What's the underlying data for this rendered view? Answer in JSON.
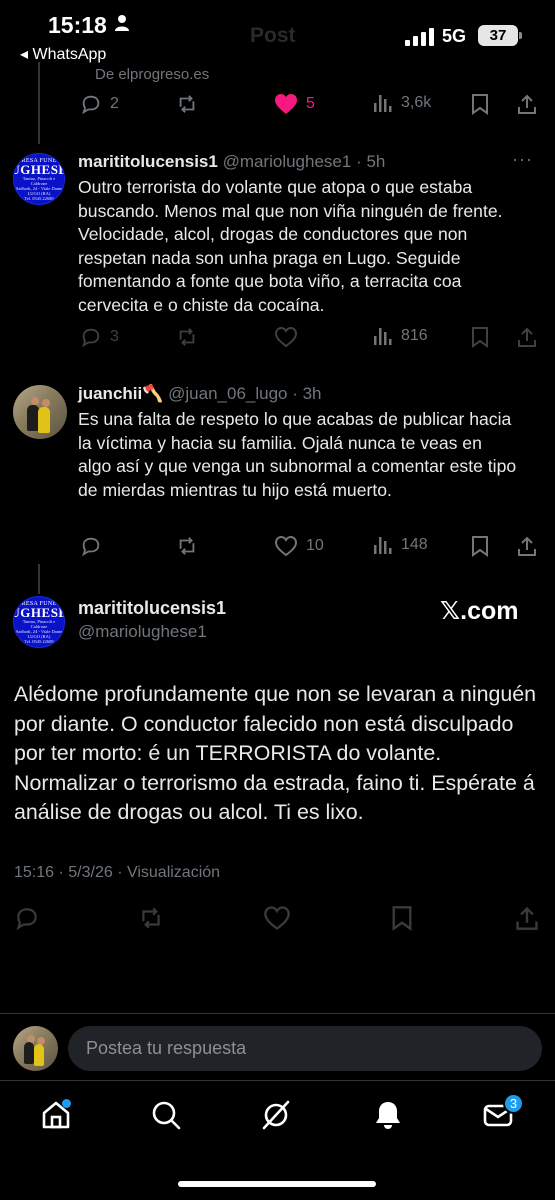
{
  "status_bar": {
    "time": "15:18",
    "back_app": "◂ WhatsApp",
    "network": "5G",
    "battery": "37"
  },
  "header": {
    "title": "Post"
  },
  "context_tweet": {
    "source": "De elprogreso.es",
    "replies": "2",
    "retweets": "",
    "likes": "5",
    "views": "3,6k"
  },
  "replies": [
    {
      "name": "marititolucensis1",
      "handle": "@mariolughese1 · 5h",
      "avatar_text": [
        "RESA FUNE",
        "UGHESE",
        "Tanino, Pinacoli e Caldrone",
        "Sadhodi, 24 - Viale Dante",
        "LUGO (RA)",
        "Tel. 0545.22688"
      ],
      "text": "Outro terrorista do volante que atopa o que estaba buscando. Menos mal que non viña ninguén de frente. Velocidade, alcol, drogas de conductores que non respetan nada son unha praga en Lugo. Seguide fomentando a fonte que bota viño, a terracita coa cervecita e o chiste da cocaína.",
      "replies": "3",
      "likes": "",
      "views": "816"
    },
    {
      "name": "juanchii🪓",
      "handle": "@juan_06_lugo · 3h",
      "text": "Es una falta de respeto lo que acabas de publicar hacia la víctima y hacia su familia. Ojalá nunca te veas en algo así y que venga un subnormal a comentar este tipo de mierdas mientras tu hijo está muerto.",
      "replies": "",
      "likes": "10",
      "views": "148"
    }
  ],
  "main_tweet": {
    "name": "marititolucensis1",
    "handle": "@mariolughese1",
    "avatar_text": [
      "RESA FUNE",
      "UGHESE",
      "Tanino, Pinacoli e Caldrone",
      "Sadhodi, 24 - Viale Dante",
      "LUGO (RA)",
      "Tel. 0545.22688"
    ],
    "watermark": "𝕏.com",
    "text": "Alédome profundamente que non se levaran a ninguén por diante. O conductor falecido non está disculpado por ter morto: é un TERRORISTA do volante. Normalizar o terrorismo da estrada, faino ti. Espérate á análise de drogas ou alcol. Ti es lixo.",
    "meta": "15:16 · 5/3/26 · Visualización"
  },
  "composer": {
    "placeholder": "Postea tu respuesta"
  },
  "tabbar": {
    "messages_badge": "3"
  },
  "colors": {
    "accent": "#1d9bf0",
    "like": "#f91880",
    "muted": "#71767b"
  }
}
